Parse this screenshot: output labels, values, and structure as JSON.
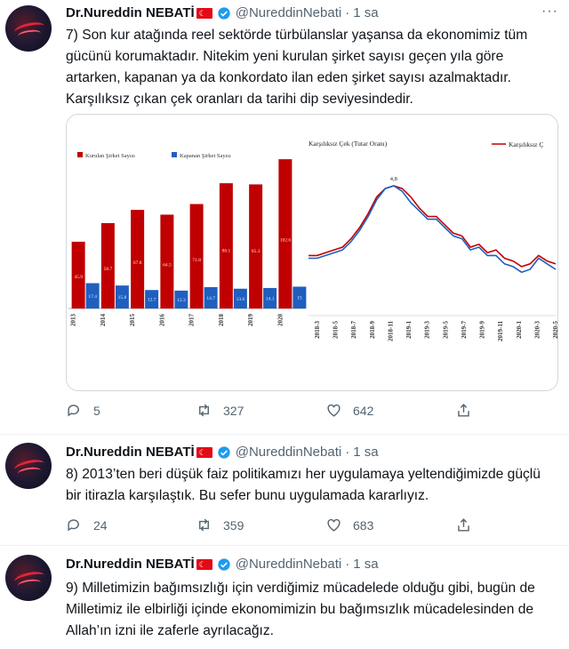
{
  "tweets": [
    {
      "author": "Dr.Nureddin NEBATİ",
      "handle": "@NureddinNebati",
      "time": "1 sa",
      "text": "7) Son kur atağında reel sektörde türbülanslar yaşansa da ekonomimiz tüm gücünü korumaktadır. Nitekim yeni kurulan şirket sayısı geçen yıla göre artarken, kapanan ya da konkordato ilan eden şirket sayısı azalmaktadır. Karşılıksız çıkan çek oranları da tarihi dip seviyesindedir.",
      "replies": "5",
      "retweets": "327",
      "likes": "642"
    },
    {
      "author": "Dr.Nureddin NEBATİ",
      "handle": "@NureddinNebati",
      "time": "1 sa",
      "text": "8) 2013’ten beri düşük faiz politikamızı her uygulamaya yeltendiğimizde güçlü bir itirazla karşılaştık. Bu sefer bunu uygulamada kararlıyız.",
      "replies": "24",
      "retweets": "359",
      "likes": "683"
    },
    {
      "author": "Dr.Nureddin NEBATİ",
      "handle": "@NureddinNebati",
      "time": "1 sa",
      "text": "9) Milletimizin bağımsızlığı için verdiğimiz mücadelede olduğu gibi, bugün de Milletimiz ile elbirliği içinde ekonomimizin bu bağımsızlık mücadelesinden de Allah’ın izni ile zaferle ayrılacağız."
    }
  ],
  "more_label": "···",
  "flag_glyph": "☾",
  "colors": {
    "founded": "#c00000",
    "closed": "#1f5fbf",
    "line1": "#c00000",
    "line2": "#1f5fbf",
    "verified": "#1d9bf0"
  },
  "chart_data": [
    {
      "type": "bar",
      "legend": [
        "Kurulan Şirket Sayısı",
        "Kapanan Şirket Sayısı"
      ],
      "categories": [
        "2013",
        "2014",
        "2015",
        "2016",
        "2017",
        "2018",
        "2019",
        "2020"
      ],
      "series": [
        {
          "name": "Kurulan Şirket Sayısı",
          "values": [
            45.9,
            58.7,
            67.8,
            64.5,
            71.8,
            86.1,
            85.3,
            102.6
          ],
          "labels": [
            "45.9",
            "58.7",
            "67.8",
            "64.5",
            "71.8",
            "86.1",
            "85.3",
            "102.6"
          ]
        },
        {
          "name": "Kapanan Şirket Sayısı",
          "values": [
            17.4,
            15.8,
            12.7,
            12.3,
            14.7,
            13.6,
            14.1,
            15.0
          ],
          "labels": [
            "17.4",
            "15.8",
            "12.7",
            "12.3",
            "14.7",
            "13.6",
            "14.1",
            "15"
          ]
        }
      ],
      "ylim": [
        0,
        110
      ]
    },
    {
      "type": "line",
      "title": "Karşılıksız Çek (Tutar Oranı)",
      "legend": [
        "Karşılıksız Ç"
      ],
      "x_labels": [
        "2018-3",
        "2018-5",
        "2018-7",
        "2018-9",
        "2018-11",
        "2019-1",
        "2019-3",
        "2019-5",
        "2019-7",
        "2019-9",
        "2019-11",
        "2020-1",
        "2020-3",
        "2020-5"
      ],
      "peak_label": "4,8",
      "series": [
        {
          "name": "red",
          "values": [
            2.2,
            2.2,
            2.3,
            2.4,
            2.5,
            2.8,
            3.2,
            3.7,
            4.3,
            4.6,
            4.7,
            4.6,
            4.3,
            3.9,
            3.6,
            3.6,
            3.3,
            3.0,
            2.9,
            2.5,
            2.6,
            2.3,
            2.4,
            2.1,
            2.0,
            1.8,
            1.9,
            2.2,
            2.0,
            1.9
          ]
        },
        {
          "name": "blue",
          "values": [
            2.1,
            2.1,
            2.2,
            2.3,
            2.4,
            2.7,
            3.1,
            3.6,
            4.2,
            4.6,
            4.7,
            4.5,
            4.1,
            3.8,
            3.5,
            3.5,
            3.2,
            2.9,
            2.8,
            2.4,
            2.5,
            2.2,
            2.2,
            1.9,
            1.8,
            1.6,
            1.7,
            2.1,
            1.9,
            1.7
          ]
        }
      ],
      "ylim": [
        1.0,
        5.4
      ]
    }
  ]
}
